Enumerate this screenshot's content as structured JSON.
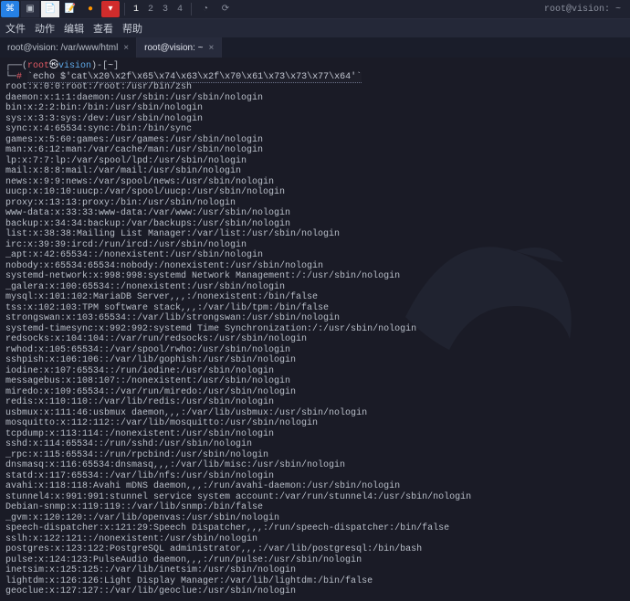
{
  "taskbar": {
    "workspaces": [
      "1",
      "2",
      "3",
      "4"
    ],
    "active_workspace": "1",
    "right_label": "root@vision: ~"
  },
  "menubar": {
    "items": [
      "文件",
      "动作",
      "编辑",
      "查看",
      "帮助"
    ]
  },
  "tabs": [
    {
      "label": "root@vision: /var/www/html",
      "active": false
    },
    {
      "label": "root@vision: ~",
      "active": true
    }
  ],
  "prompt": {
    "open": "┌──(",
    "user": "root",
    "at": "㉿",
    "host": "vision",
    "close": ")-[",
    "path": "~",
    "end": "]",
    "line2_prefix": "└─",
    "hash": "#"
  },
  "command": "`echo $'cat\\x20\\x2f\\x65\\x74\\x63\\x2f\\x70\\x61\\x73\\x73\\x77\\x64'`",
  "output": [
    "root:x:0:0:root:/root:/usr/bin/zsh",
    "daemon:x:1:1:daemon:/usr/sbin:/usr/sbin/nologin",
    "bin:x:2:2:bin:/bin:/usr/sbin/nologin",
    "sys:x:3:3:sys:/dev:/usr/sbin/nologin",
    "sync:x:4:65534:sync:/bin:/bin/sync",
    "games:x:5:60:games:/usr/games:/usr/sbin/nologin",
    "man:x:6:12:man:/var/cache/man:/usr/sbin/nologin",
    "lp:x:7:7:lp:/var/spool/lpd:/usr/sbin/nologin",
    "mail:x:8:8:mail:/var/mail:/usr/sbin/nologin",
    "news:x:9:9:news:/var/spool/news:/usr/sbin/nologin",
    "uucp:x:10:10:uucp:/var/spool/uucp:/usr/sbin/nologin",
    "proxy:x:13:13:proxy:/bin:/usr/sbin/nologin",
    "www-data:x:33:33:www-data:/var/www:/usr/sbin/nologin",
    "backup:x:34:34:backup:/var/backups:/usr/sbin/nologin",
    "list:x:38:38:Mailing List Manager:/var/list:/usr/sbin/nologin",
    "irc:x:39:39:ircd:/run/ircd:/usr/sbin/nologin",
    "_apt:x:42:65534::/nonexistent:/usr/sbin/nologin",
    "nobody:x:65534:65534:nobody:/nonexistent:/usr/sbin/nologin",
    "systemd-network:x:998:998:systemd Network Management:/:/usr/sbin/nologin",
    "_galera:x:100:65534::/nonexistent:/usr/sbin/nologin",
    "mysql:x:101:102:MariaDB Server,,,:/nonexistent:/bin/false",
    "tss:x:102:103:TPM software stack,,,:/var/lib/tpm:/bin/false",
    "strongswan:x:103:65534::/var/lib/strongswan:/usr/sbin/nologin",
    "systemd-timesync:x:992:992:systemd Time Synchronization:/:/usr/sbin/nologin",
    "redsocks:x:104:104::/var/run/redsocks:/usr/sbin/nologin",
    "rwhod:x:105:65534::/var/spool/rwho:/usr/sbin/nologin",
    "sshpish:x:106:106::/var/lib/gophish:/usr/sbin/nologin",
    "iodine:x:107:65534::/run/iodine:/usr/sbin/nologin",
    "messagebus:x:108:107::/nonexistent:/usr/sbin/nologin",
    "miredo:x:109:65534::/var/run/miredo:/usr/sbin/nologin",
    "redis:x:110:110::/var/lib/redis:/usr/sbin/nologin",
    "usbmux:x:111:46:usbmux daemon,,,:/var/lib/usbmux:/usr/sbin/nologin",
    "mosquitto:x:112:112::/var/lib/mosquitto:/usr/sbin/nologin",
    "tcpdump:x:113:114::/nonexistent:/usr/sbin/nologin",
    "sshd:x:114:65534::/run/sshd:/usr/sbin/nologin",
    "_rpc:x:115:65534::/run/rpcbind:/usr/sbin/nologin",
    "dnsmasq:x:116:65534:dnsmasq,,,:/var/lib/misc:/usr/sbin/nologin",
    "statd:x:117:65534::/var/lib/nfs:/usr/sbin/nologin",
    "avahi:x:118:118:Avahi mDNS daemon,,,:/run/avahi-daemon:/usr/sbin/nologin",
    "stunnel4:x:991:991:stunnel service system account:/var/run/stunnel4:/usr/sbin/nologin",
    "Debian-snmp:x:119:119::/var/lib/snmp:/bin/false",
    "_gvm:x:120:120::/var/lib/openvas:/usr/sbin/nologin",
    "speech-dispatcher:x:121:29:Speech Dispatcher,,,:/run/speech-dispatcher:/bin/false",
    "sslh:x:122:121::/nonexistent:/usr/sbin/nologin",
    "postgres:x:123:122:PostgreSQL administrator,,,:/var/lib/postgresql:/bin/bash",
    "pulse:x:124:123:PulseAudio daemon,,,:/run/pulse:/usr/sbin/nologin",
    "inetsim:x:125:125::/var/lib/inetsim:/usr/sbin/nologin",
    "lightdm:x:126:126:Light Display Manager:/var/lib/lightdm:/bin/false",
    "geoclue:x:127:127::/var/lib/geoclue:/usr/sbin/nologin"
  ]
}
